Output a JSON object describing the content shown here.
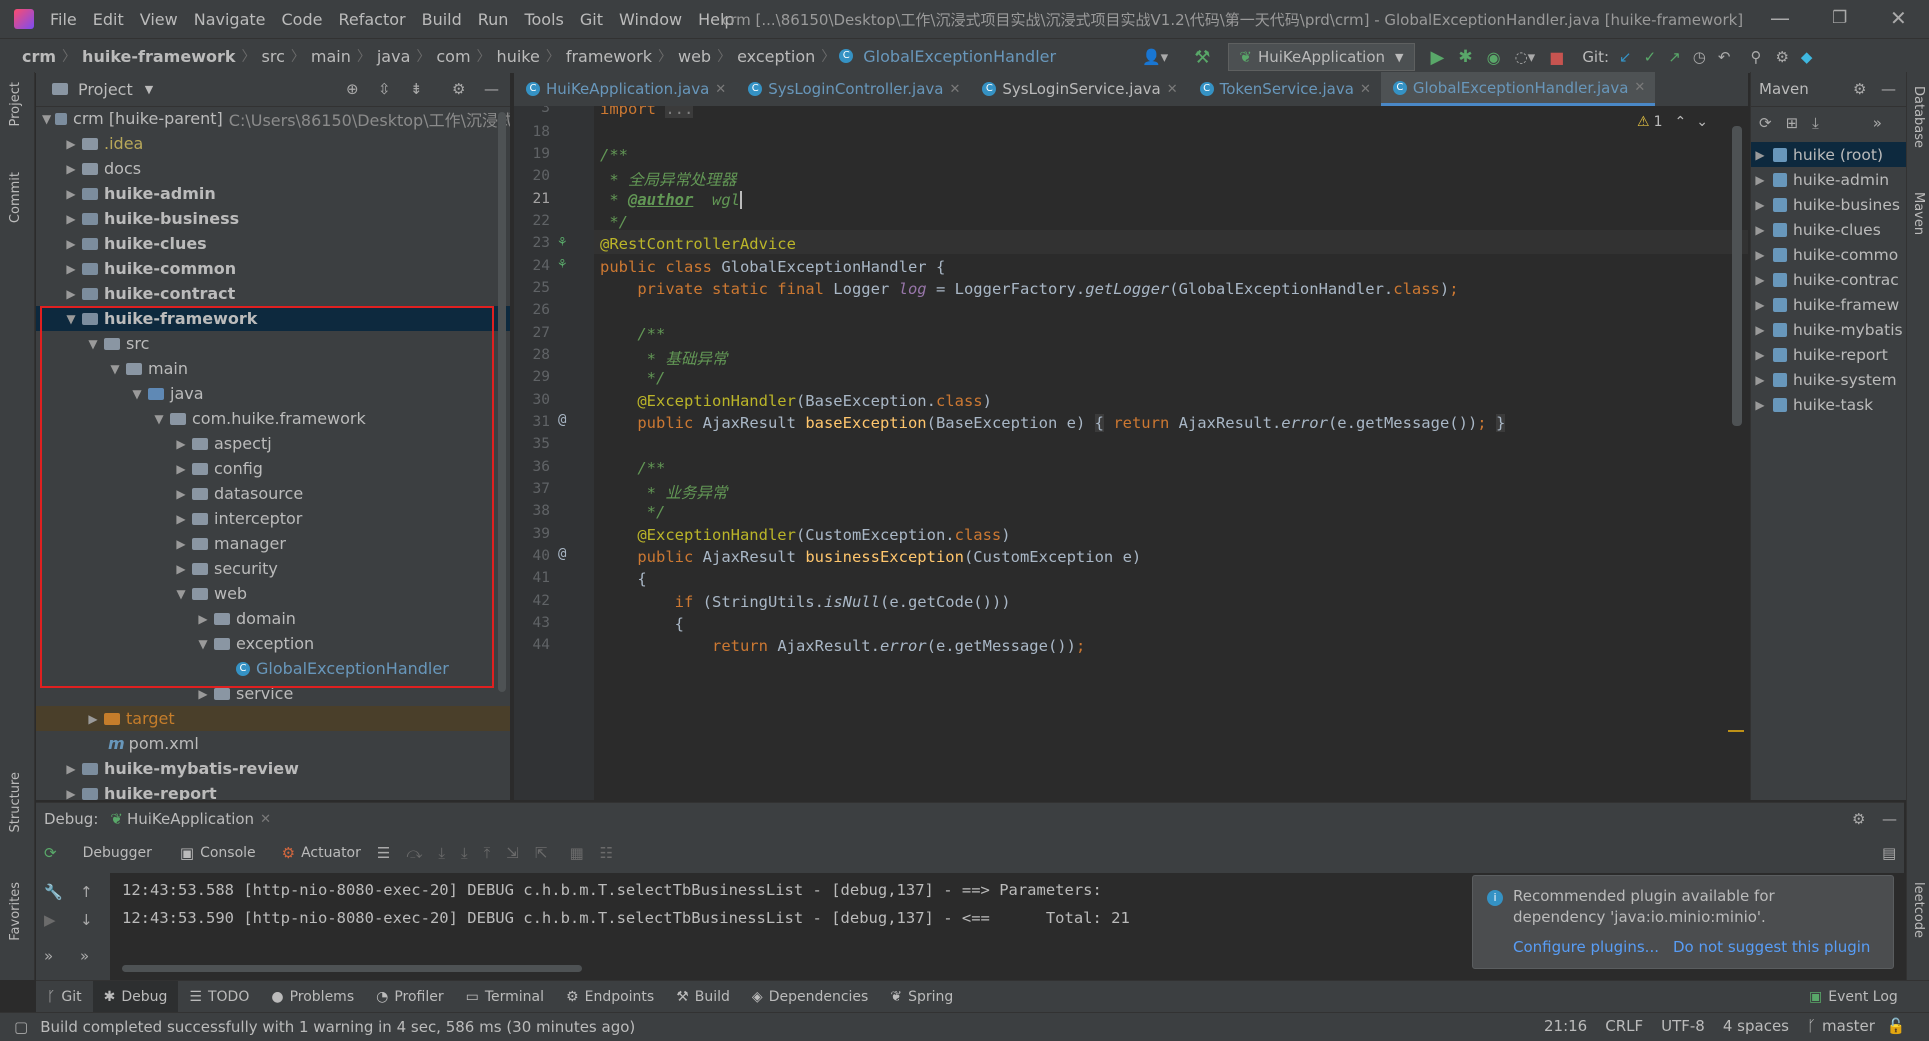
{
  "menu": [
    "File",
    "Edit",
    "View",
    "Navigate",
    "Code",
    "Refactor",
    "Build",
    "Run",
    "Tools",
    "Git",
    "Window",
    "Help"
  ],
  "window_title": "crm [...\\86150\\Desktop\\工作\\沉浸式项目实战\\沉浸式项目实战V1.2\\代码\\第一天代码\\prd\\crm] - GlobalExceptionHandler.java [huike-framework]",
  "breadcrumb": [
    "crm",
    "huike-framework",
    "src",
    "main",
    "java",
    "com",
    "huike",
    "framework",
    "web",
    "exception",
    "GlobalExceptionHandler"
  ],
  "run_config": "HuiKeApplication",
  "git_label": "Git:",
  "project": {
    "title": "Project",
    "root_name": "crm [huike-parent]",
    "root_path": "C:\\Users\\86150\\Desktop\\工作\\沉浸式",
    "items": [
      {
        "label": ".idea"
      },
      {
        "label": "docs"
      },
      {
        "label": "huike-admin"
      },
      {
        "label": "huike-business"
      },
      {
        "label": "huike-clues"
      },
      {
        "label": "huike-common"
      },
      {
        "label": "huike-contract"
      },
      {
        "label": "huike-framework"
      },
      {
        "label": "src"
      },
      {
        "label": "main"
      },
      {
        "label": "java"
      },
      {
        "label": "com.huike.framework"
      },
      {
        "label": "aspectj"
      },
      {
        "label": "config"
      },
      {
        "label": "datasource"
      },
      {
        "label": "interceptor"
      },
      {
        "label": "manager"
      },
      {
        "label": "security"
      },
      {
        "label": "web"
      },
      {
        "label": "domain"
      },
      {
        "label": "exception"
      },
      {
        "label": "GlobalExceptionHandler"
      },
      {
        "label": "service"
      },
      {
        "label": "target"
      },
      {
        "label": "pom.xml"
      },
      {
        "label": "huike-mybatis-review"
      },
      {
        "label": "huike-report"
      }
    ]
  },
  "tabs": [
    "HuiKeApplication.java",
    "SysLoginController.java",
    "SysLoginService.java",
    "TokenService.java",
    "GlobalExceptionHandler.java"
  ],
  "editor": {
    "warning_count": "1",
    "line_numbers": [
      "3",
      "18",
      "19",
      "20",
      "21",
      "22",
      "23",
      "24",
      "25",
      "26",
      "27",
      "28",
      "29",
      "30",
      "31",
      "35",
      "36",
      "37",
      "38",
      "39",
      "40",
      "41",
      "42",
      "43",
      "44"
    ]
  },
  "maven": {
    "title": "Maven",
    "items": [
      "huike (root)",
      "huike-admin",
      "huike-busines",
      "huike-clues",
      "huike-commo",
      "huike-contrac",
      "huike-framew",
      "huike-mybatis",
      "huike-report",
      "huike-system",
      "huike-task"
    ]
  },
  "debug": {
    "label": "Debug:",
    "session": "HuiKeApplication",
    "tabs": [
      "Debugger",
      "Console",
      "Actuator"
    ],
    "lines": [
      "12:43:53.588 [http-nio-8080-exec-20] DEBUG c.h.b.m.T.selectTbBusinessList - [debug,137] - ==> Parameters: ",
      "12:43:53.590 [http-nio-8080-exec-20] DEBUG c.h.b.m.T.selectTbBusinessList - [debug,137] - <==      Total: 21"
    ]
  },
  "notification": {
    "text_line1": "Recommended plugin available for",
    "text_line2": "dependency 'java:io.minio:minio'.",
    "action1": "Configure plugins...",
    "action2": "Do not suggest this plugin"
  },
  "toolwindows": [
    "Git",
    "Debug",
    "TODO",
    "Problems",
    "Profiler",
    "Terminal",
    "Endpoints",
    "Build",
    "Dependencies",
    "Spring"
  ],
  "event_log": "Event Log",
  "side_labels": {
    "project": "Project",
    "commit": "Commit",
    "structure": "Structure",
    "favorites": "Favorites",
    "database": "Database",
    "maven": "Maven",
    "leetcode": "leetcode"
  },
  "status": {
    "message": "Build completed successfully with 1 warning in 4 sec, 586 ms (30 minutes ago)",
    "position": "21:16",
    "line_sep": "CRLF",
    "encoding": "UTF-8",
    "indent": "4 spaces",
    "branch": "master"
  }
}
